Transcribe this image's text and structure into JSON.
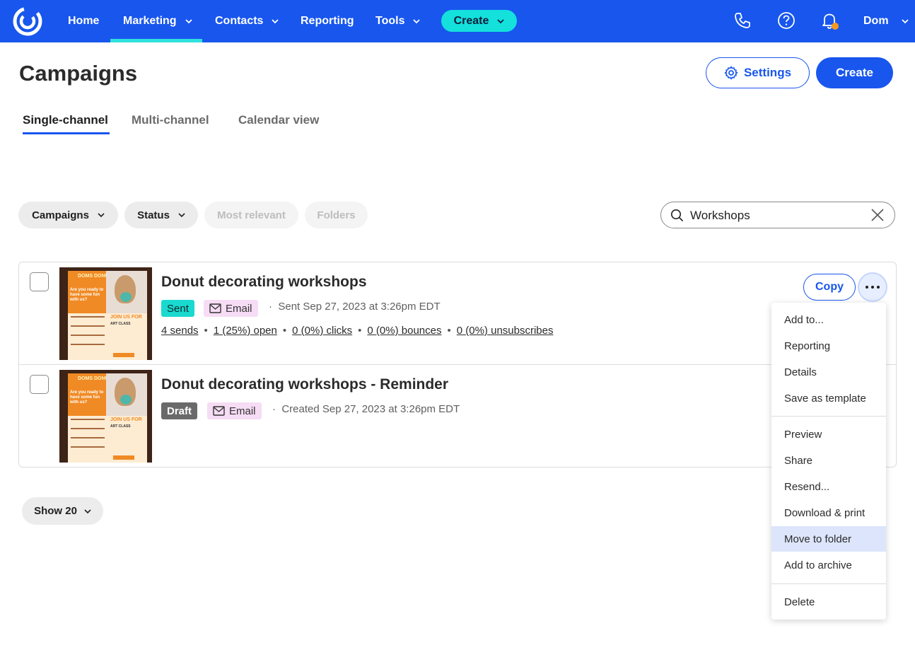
{
  "nav": {
    "items": [
      {
        "label": "Home",
        "has_menu": false
      },
      {
        "label": "Marketing",
        "has_menu": true,
        "active": true
      },
      {
        "label": "Contacts",
        "has_menu": true
      },
      {
        "label": "Reporting",
        "has_menu": false
      },
      {
        "label": "Tools",
        "has_menu": true
      }
    ],
    "create_label": "Create",
    "user_label": "Dom",
    "icons": [
      "phone-icon",
      "help-icon",
      "bell-icon"
    ],
    "colors": {
      "bar": "#1856ed",
      "accent": "#2fe1dc",
      "notification": "#f8991c"
    }
  },
  "header": {
    "title": "Campaigns",
    "settings_label": "Settings",
    "create_label": "Create"
  },
  "tabs": [
    {
      "label": "Single-channel",
      "active": true
    },
    {
      "label": "Multi-channel"
    },
    {
      "label": "Calendar view"
    }
  ],
  "filters": {
    "campaigns_label": "Campaigns",
    "status_label": "Status",
    "sort_label": "Most relevant",
    "folders_label": "Folders",
    "search_value": "Workshops"
  },
  "campaigns": [
    {
      "title": "Donut decorating workshops",
      "status": "Sent",
      "channel": "Email",
      "meta": "Sent Sep 27, 2023 at 3:26pm EDT",
      "stats": {
        "sends": "4 sends",
        "opens": "1 (25%) open",
        "clicks": "0 (0%) clicks",
        "bounces": "0 (0%) bounces",
        "unsubscribes": "0 (0%) unsubscribes"
      },
      "copy_label": "Copy"
    },
    {
      "title": "Donut decorating workshops - Reminder",
      "status": "Draft",
      "channel": "Email",
      "meta": "Created Sep 27, 2023 at 3:26pm EDT"
    }
  ],
  "thumbnail": {
    "brand": "DOMS DONUTS",
    "hero": "Are you ready to have some fun with us?",
    "headline": "JOIN US FOR",
    "subline": "ART CLASS"
  },
  "menu": {
    "group1": [
      "Add to...",
      "Reporting",
      "Details",
      "Save as template"
    ],
    "group2": [
      "Preview",
      "Share",
      "Resend...",
      "Download & print",
      "Move to folder",
      "Add to archive"
    ],
    "group3": [
      "Delete"
    ],
    "highlighted": "Move to folder"
  },
  "pagination": {
    "show_label": "Show 20"
  }
}
